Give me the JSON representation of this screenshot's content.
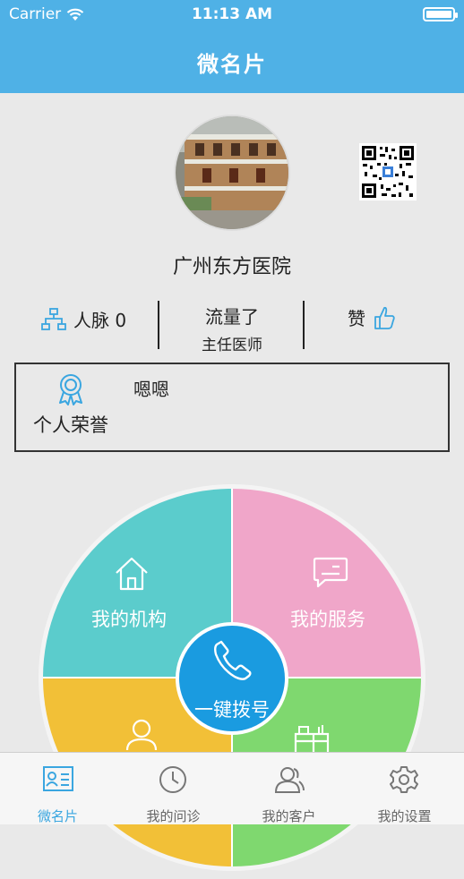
{
  "status_bar": {
    "carrier": "Carrier",
    "time": "11:13 AM"
  },
  "header": {
    "title": "微名片"
  },
  "profile": {
    "name": "广州东方医院"
  },
  "stats": {
    "network_label": "人脉 0",
    "traffic_label": "流量了",
    "position": "主任医师",
    "like_label": "赞"
  },
  "honor": {
    "label": "个人荣誉",
    "text": "嗯嗯"
  },
  "wheel": {
    "segments": [
      {
        "label": "我的机构",
        "icon": "house-icon",
        "color": "#5bcccc"
      },
      {
        "label": "我的服务",
        "icon": "message-icon",
        "color": "#f0a6c9"
      },
      {
        "label": "",
        "icon": "person-icon",
        "color": "#f2c037"
      },
      {
        "label": "",
        "icon": "desk-icon",
        "color": "#7fd86f"
      }
    ],
    "call_label": "一键拨号"
  },
  "tabbar": {
    "items": [
      {
        "label": "微名片",
        "icon": "card-icon",
        "active": true
      },
      {
        "label": "我的问诊",
        "icon": "clock-icon",
        "active": false
      },
      {
        "label": "我的客户",
        "icon": "users-icon",
        "active": false
      },
      {
        "label": "我的设置",
        "icon": "gear-icon",
        "active": false
      }
    ]
  }
}
